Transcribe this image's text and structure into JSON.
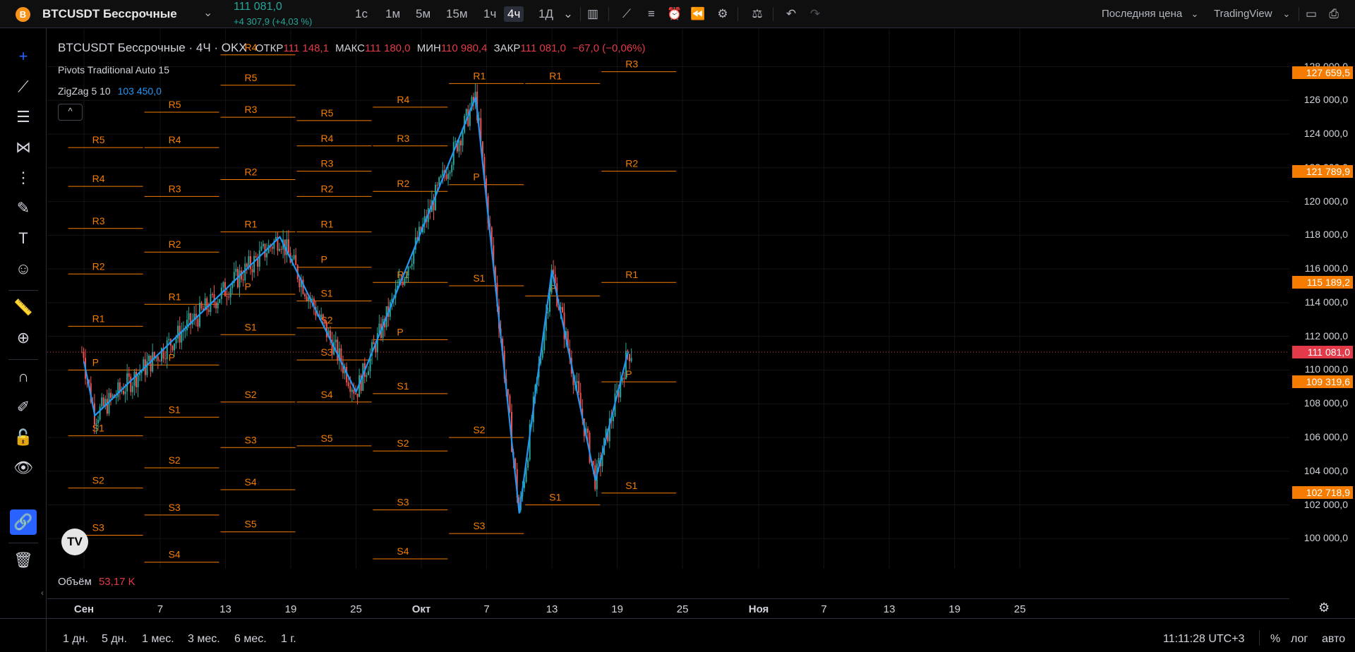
{
  "header": {
    "coin_icon": "B",
    "symbol": "BTCUSDT Бессрочные",
    "price": "111 081,0",
    "change": "+4 307,9 (+4,03 %)",
    "timeframes": [
      "1с",
      "1м",
      "5м",
      "15м",
      "1ч",
      "4ч",
      "1Д"
    ],
    "active_timeframe": "4ч",
    "price_type": "Последняя цена",
    "provider": "TradingView"
  },
  "legend": {
    "title": "BTCUSDT Бессрочные · 4Ч · OKX",
    "open_label": "ОТКР",
    "open": "111 148,1",
    "high_label": "МАКС",
    "high": "111 180,0",
    "low_label": "МИН",
    "low": "110 980,4",
    "close_label": "ЗАКР",
    "close": "111 081,0",
    "close_change": "−67,0 (−0,06%)",
    "pivots": "Pivots Traditional Auto 15",
    "zigzag": "ZigZag 5 10",
    "zigzag_value": "103 450,0",
    "collapse": "^"
  },
  "volume": {
    "label": "Объём",
    "value": "53,17 K"
  },
  "price_axis": {
    "ticks": [
      "128 000,0",
      "126 000,0",
      "124 000,0",
      "122 000,0",
      "120 000,0",
      "118 000,0",
      "116 000,0",
      "114 000,0",
      "112 000,0",
      "110 000,0",
      "108 000,0",
      "106 000,0",
      "104 000,0",
      "102 000,0",
      "100 000,0"
    ],
    "tags": [
      {
        "value": "127 659,5",
        "color": "#f57c00"
      },
      {
        "value": "121 789,9",
        "color": "#f57c00"
      },
      {
        "value": "115 189,2",
        "color": "#f57c00"
      },
      {
        "value": "111 081,0",
        "color": "#e23a48"
      },
      {
        "value": "109 319,6",
        "color": "#f57c00"
      },
      {
        "value": "102 718,9",
        "color": "#f57c00"
      }
    ]
  },
  "time_axis": [
    "Сен",
    "7",
    "13",
    "19",
    "25",
    "Окт",
    "7",
    "13",
    "19",
    "25",
    "Ноя",
    "7",
    "13",
    "19",
    "25"
  ],
  "chart_data": {
    "type": "candlestick",
    "symbol": "BTCUSDT",
    "timeframe": "4h",
    "last_price": 111081.0,
    "ylim": [
      98500,
      129000
    ],
    "zigzag": [
      {
        "date": "Aug 31",
        "price": 110500
      },
      {
        "date": "Sep 1",
        "price": 107300
      },
      {
        "date": "Sep 18",
        "price": 117900
      },
      {
        "date": "Sep 25",
        "price": 108700
      },
      {
        "date": "Oct 6",
        "price": 126200
      },
      {
        "date": "Oct 10",
        "price": 101500
      },
      {
        "date": "Oct 13",
        "price": 115900
      },
      {
        "date": "Oct 17",
        "price": 103450
      },
      {
        "date": "Oct 20",
        "price": 111081
      }
    ],
    "pivot_periods": [
      {
        "levels": {
          "R5": 123200,
          "R4": 120900,
          "R3": 118400,
          "R2": 115700,
          "R1": 112600,
          "P": 110000,
          "S1": 106100,
          "S2": 103000,
          "S3": 100200,
          "S4": 97500
        }
      },
      {
        "levels": {
          "R5": 125300,
          "R4": 123200,
          "R3": 120300,
          "R2": 117000,
          "R1": 113900,
          "P": 110300,
          "S1": 107200,
          "S2": 104200,
          "S3": 101400,
          "S4": 98600
        }
      },
      {
        "levels": {
          "R5": 126900,
          "R4": 128700,
          "R3": 125000,
          "R2": 121300,
          "R1": 118200,
          "P": 114500,
          "S1": 112100,
          "S2": 108100,
          "S3": 105400,
          "S4": 102900,
          "S5": 100400
        }
      },
      {
        "levels": {
          "R5": 124800,
          "R4": 123300,
          "R3": 121800,
          "R2": 120300,
          "R1": 118200,
          "P": 116100,
          "S1": 114100,
          "S2": 112500,
          "S3": 110600,
          "S4": 108100,
          "S5": 105500
        }
      },
      {
        "levels": {
          "R4": 125600,
          "R3": 123300,
          "R2": 120600,
          "R1": 115200,
          "P": 111800,
          "S1": 108600,
          "S2": 105200,
          "S3": 101700,
          "S4": 98800
        }
      },
      {
        "levels": {
          "R1": 127000,
          "P": 121000,
          "S1": 115000,
          "S2": 106000,
          "S3": 100300
        }
      },
      {
        "levels": {
          "R1": 127000,
          "P": 114400,
          "S1": 102000
        }
      },
      {
        "levels": {
          "R3": 127700,
          "R2": 121800,
          "R1": 115200,
          "P": 109300,
          "S1": 102700
        }
      }
    ],
    "volume_last": "53,17 K"
  },
  "bottom": {
    "ranges": [
      "1 дн.",
      "5 дн.",
      "1 мес.",
      "3 мес.",
      "6 мес.",
      "1 г."
    ],
    "time": "11:11:28 UTC+3",
    "percent": "%",
    "log": "лог",
    "auto": "авто"
  }
}
